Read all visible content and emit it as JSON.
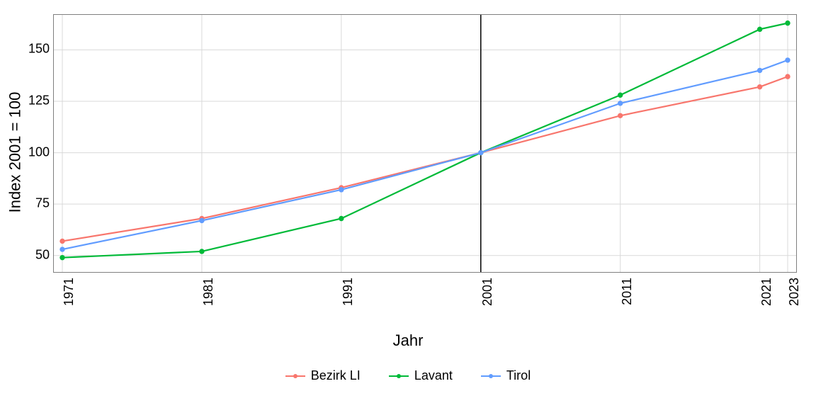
{
  "chart_data": {
    "type": "line",
    "title": "",
    "xlabel": "Jahr",
    "ylabel": "Index 2001 = 100",
    "x": [
      1971,
      1981,
      1991,
      2001,
      2011,
      2021,
      2023
    ],
    "x_ticks": [
      1971,
      1981,
      1991,
      2001,
      2011,
      2021,
      2023
    ],
    "y_ticks": [
      50,
      75,
      100,
      125,
      150
    ],
    "xlim": [
      1971,
      2023
    ],
    "ylim": [
      42,
      167
    ],
    "vline_x": 2001,
    "legend_position": "bottom",
    "series": [
      {
        "name": "Bezirk LI",
        "color": "#F8766D",
        "values": [
          57,
          68,
          83,
          100,
          118,
          132,
          137
        ]
      },
      {
        "name": "Lavant",
        "color": "#00BA38",
        "values": [
          49,
          52,
          68,
          100,
          128,
          160,
          163
        ]
      },
      {
        "name": "Tirol",
        "color": "#619CFF",
        "values": [
          53,
          67,
          82,
          100,
          124,
          140,
          145
        ]
      }
    ]
  }
}
